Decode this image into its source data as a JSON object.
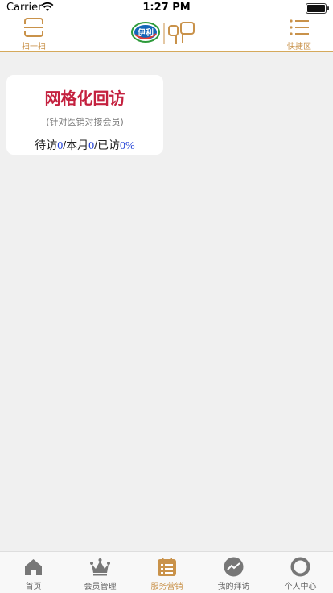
{
  "status_bar": {
    "carrier": "Carrier",
    "time": "1:27 PM"
  },
  "nav": {
    "scan_label": "扫一扫",
    "quick_label": "快捷区",
    "logo_text": "伊利"
  },
  "card": {
    "title": "网格化回访",
    "subtitle": "(针对医销对接会员)",
    "pending_label": "待访",
    "pending_value": "0",
    "month_label": "/本月",
    "month_value": "0",
    "visited_label": "/已访",
    "visited_value": "0%"
  },
  "tabbar": {
    "items": [
      {
        "label": "首页",
        "icon": "home-icon"
      },
      {
        "label": "会员管理",
        "icon": "crown-icon"
      },
      {
        "label": "服务营销",
        "icon": "list-icon"
      },
      {
        "label": "我的拜访",
        "icon": "trend-icon"
      },
      {
        "label": "个人中心",
        "icon": "person-icon"
      }
    ],
    "active_index": 2
  },
  "colors": {
    "accent": "#c9924a",
    "title_red": "#c4213f",
    "number_blue": "#1f3fd6",
    "background": "#f0f0f0"
  }
}
